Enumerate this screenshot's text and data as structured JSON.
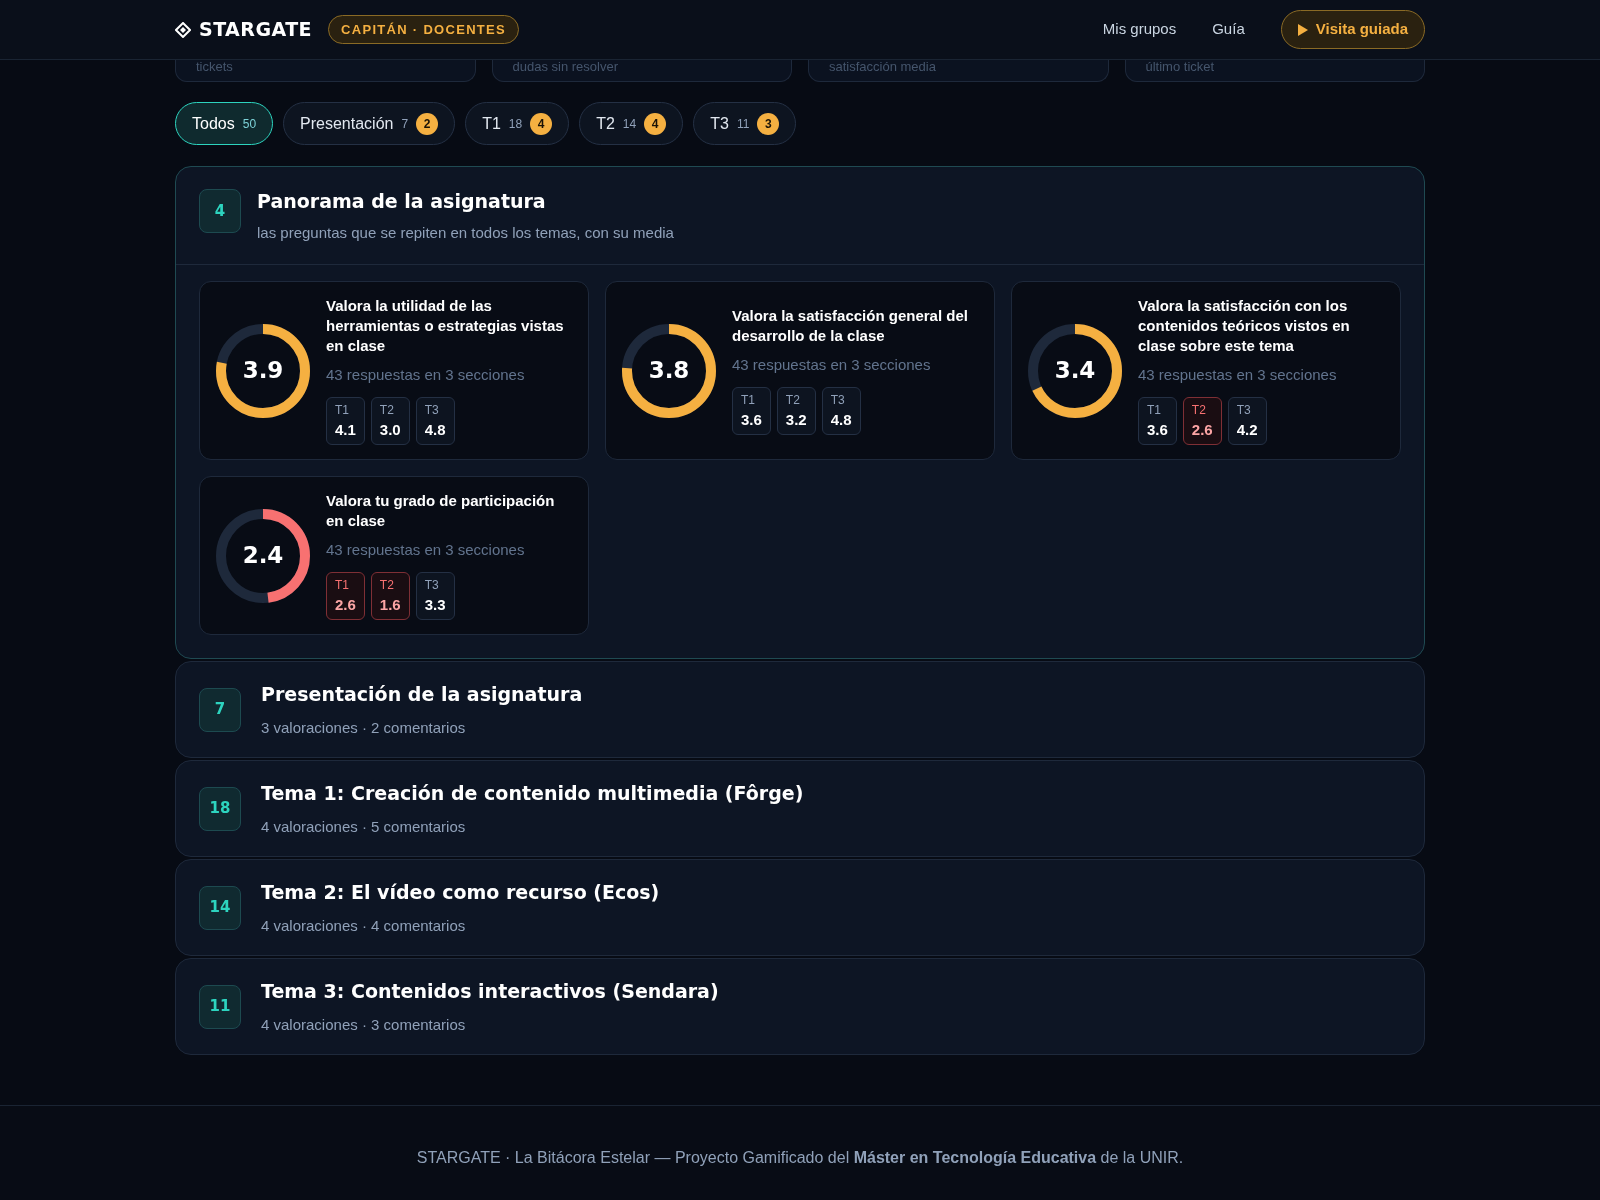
{
  "header": {
    "logo": "STARGATE",
    "role_badge": "CAPITÁN · DOCENTES",
    "nav": [
      "Mis grupos",
      "Guía"
    ],
    "tour_button": "Visita guiada"
  },
  "stat_cards": [
    {
      "label": "tickets"
    },
    {
      "label": "dudas sin resolver"
    },
    {
      "label": "satisfacción media"
    },
    {
      "label": "último ticket"
    }
  ],
  "filters": [
    {
      "label": "Todos",
      "count": "50",
      "selected": true
    },
    {
      "label": "Presentación",
      "count": "7",
      "badge": "2",
      "selected": false
    },
    {
      "label": "T1",
      "count": "18",
      "badge": "4",
      "selected": false
    },
    {
      "label": "T2",
      "count": "14",
      "badge": "4",
      "selected": false
    },
    {
      "label": "T3",
      "count": "11",
      "badge": "3",
      "selected": false
    }
  ],
  "overview": {
    "number": "4",
    "title": "Panorama de la asignatura",
    "subtitle": "las preguntas que se repiten en todos los temas, con su media",
    "expanded": true,
    "questions": [
      {
        "score": "3.9",
        "level": 0.78,
        "low": false,
        "question": "Valora la utilidad de las herramientas o estrategias vistas en clase",
        "responses": "43 respuestas en 3 secciones",
        "sections": [
          {
            "label": "T1",
            "value": "4.1",
            "low": false
          },
          {
            "label": "T2",
            "value": "3.0",
            "low": false
          },
          {
            "label": "T3",
            "value": "4.8",
            "low": false
          }
        ]
      },
      {
        "score": "3.8",
        "level": 0.76,
        "low": false,
        "question": "Valora la satisfacción general del desarrollo de la clase",
        "responses": "43 respuestas en 3 secciones",
        "sections": [
          {
            "label": "T1",
            "value": "3.6",
            "low": false
          },
          {
            "label": "T2",
            "value": "3.2",
            "low": false
          },
          {
            "label": "T3",
            "value": "4.8",
            "low": false
          }
        ]
      },
      {
        "score": "3.4",
        "level": 0.68,
        "low": false,
        "question": "Valora la satisfacción con los contenidos teóricos vistos en clase sobre este tema",
        "responses": "43 respuestas en 3 secciones",
        "sections": [
          {
            "label": "T1",
            "value": "3.6",
            "low": false
          },
          {
            "label": "T2",
            "value": "2.6",
            "low": true
          },
          {
            "label": "T3",
            "value": "4.2",
            "low": false
          }
        ]
      },
      {
        "score": "2.4",
        "level": 0.48,
        "low": true,
        "question": "Valora tu grado de participación en clase",
        "responses": "43 respuestas en 3 secciones",
        "sections": [
          {
            "label": "T1",
            "value": "2.6",
            "low": true
          },
          {
            "label": "T2",
            "value": "1.6",
            "low": true
          },
          {
            "label": "T3",
            "value": "3.3",
            "low": false
          }
        ]
      }
    ]
  },
  "topics": [
    {
      "number": "7",
      "title": "Presentación de la asignatura",
      "subtitle": "3 valoraciones · 2 comentarios"
    },
    {
      "number": "18",
      "title": "Tema 1: Creación de contenido multimedia (Fôrge)",
      "subtitle": "4 valoraciones · 5 comentarios"
    },
    {
      "number": "14",
      "title": "Tema 2: El vídeo como recurso (Ecos)",
      "subtitle": "4 valoraciones · 4 comentarios"
    },
    {
      "number": "11",
      "title": "Tema 3: Contenidos interactivos (Sendara)",
      "subtitle": "4 valoraciones · 3 comentarios"
    }
  ],
  "footer": "STARGATE · La Bitácora Estelar — Proyecto Gamificado del **Máster en Tecnología Educativa** de la UNIR."
}
